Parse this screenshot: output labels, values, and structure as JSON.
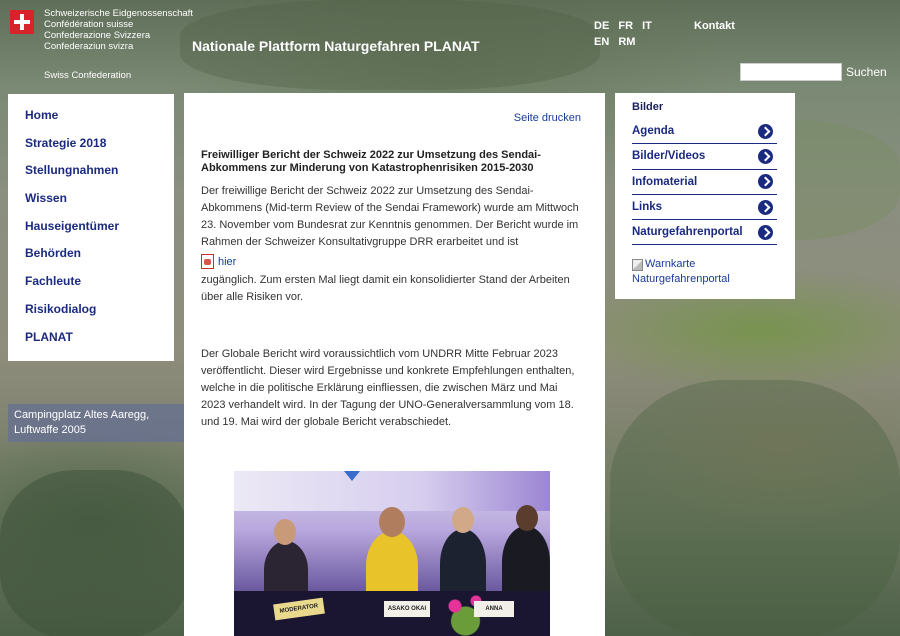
{
  "header": {
    "confederation_lines": [
      "Schweizerische Eidgenossenschaft",
      "Confédération suisse",
      "Confederazione Svizzera",
      "Confederaziun svizra"
    ],
    "swiss_confederation": "Swiss Confederation",
    "site_title": "Nationale Plattform Naturgefahren PLANAT",
    "languages_row1": [
      "DE",
      "FR",
      "IT"
    ],
    "languages_row2": [
      "EN",
      "RM"
    ],
    "contact": "Kontakt",
    "search_value": "",
    "search_button": "Suchen"
  },
  "left_nav": {
    "items": [
      "Home",
      "Strategie 2018",
      "Stellungnahmen",
      "Wissen",
      "Hauseigentümer",
      "Behörden",
      "Fachleute",
      "Risikodialog",
      "PLANAT"
    ]
  },
  "background_caption": [
    "Campingplatz Altes Aaregg,",
    "Luftwaffe 2005"
  ],
  "main": {
    "print_link": "Seite drucken",
    "headline": "Freiwilliger Bericht der Schweiz 2022 zur Umsetzung des Sendai-Abkommens zur Minderung von Katastrophenrisiken 2015-2030",
    "para1": "Der freiwillige Bericht der Schweiz 2022 zur Umsetzung des Sendai-Abkommens (Mid-term Review of the Sendai Framework) wurde am Mittwoch 23. November vom Bundesrat zur Kenntnis genommen. Der Bericht wurde im Rahmen der Schweizer Konsultativgruppe DRR erarbeitet und ist",
    "pdf_link": "hier",
    "para1_end": "zugänglich. Zum ersten Mal liegt damit ein konsolidierter Stand der Arbeiten über alle Risiken vor.",
    "para2": "Der Globale Bericht wird voraussichtlich vom UNDRR Mitte Februar 2023 veröffentlicht. Dieser wird Ergebnisse und konkrete Empfehlungen enthalten, welche in die politische Erklärung einfliessen, die zwischen März und Mai 2023 verhandelt wird. In der Tagung der UNO-Generalversammlung vom 18. und 19. Mai wird der globale Bericht verabschiedet.",
    "photo_texts": {
      "nameplate1": "MODERATOR",
      "nameplate2": "ASAKO OKAI",
      "nameplate3": "ANNA"
    }
  },
  "right_box": {
    "title": "Bilder",
    "items": [
      "Agenda",
      "Bilder/Videos",
      "Infomaterial",
      "Links",
      "Naturgefahrenportal"
    ],
    "warn_alt": "Warnkarte",
    "warn_link": "Naturgefahrenportal"
  }
}
